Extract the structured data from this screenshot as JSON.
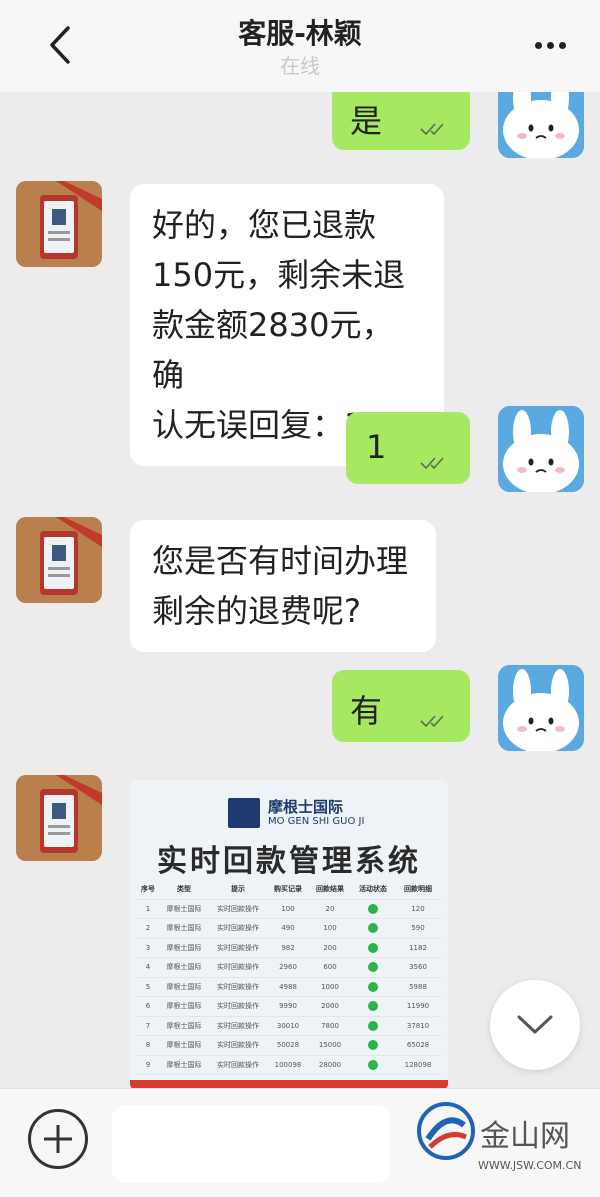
{
  "header": {
    "title": "客服-林颖",
    "status": "在线"
  },
  "messages": [
    {
      "side": "out",
      "text": "是"
    },
    {
      "side": "in",
      "lines": [
        "好的，您已退款",
        "150元，剩余未退",
        "款金额2830元，确",
        "认无误回复：1"
      ]
    },
    {
      "side": "out",
      "text": "1"
    },
    {
      "side": "in",
      "lines": [
        "您是否有时间办理",
        "剩余的退费呢?"
      ]
    },
    {
      "side": "out",
      "text": "有"
    }
  ],
  "image_message": {
    "brand_cn": "摩根士国际",
    "brand_en": "MO GEN SHI GUO JI",
    "title": "实时回款管理系统",
    "columns": [
      "序号",
      "类型",
      "提示",
      "购买记录",
      "回款结果",
      "活动状态",
      "回款明细"
    ],
    "rows": [
      [
        "1",
        "摩根士国际",
        "实时回款操作",
        "100",
        "20",
        "✓",
        "120"
      ],
      [
        "2",
        "摩根士国际",
        "实时回款操作",
        "490",
        "100",
        "✓",
        "590"
      ],
      [
        "3",
        "摩根士国际",
        "实时回款操作",
        "982",
        "200",
        "✓",
        "1182"
      ],
      [
        "4",
        "摩根士国际",
        "实时回款操作",
        "2960",
        "600",
        "✓",
        "3560"
      ],
      [
        "5",
        "摩根士国际",
        "实时回款操作",
        "4988",
        "1000",
        "✓",
        "5988"
      ],
      [
        "6",
        "摩根士国际",
        "实时回款操作",
        "9990",
        "2000",
        "✓",
        "11990"
      ],
      [
        "7",
        "摩根士国际",
        "实时回款操作",
        "30010",
        "7800",
        "✓",
        "37810"
      ],
      [
        "8",
        "摩根士国际",
        "实时回款操作",
        "50028",
        "15000",
        "✓",
        "65028"
      ],
      [
        "9",
        "摩根士国际",
        "实时回款操作",
        "100098",
        "28000",
        "✓",
        "128098"
      ]
    ]
  },
  "watermark": {
    "name": "金山网",
    "url": "WWW.JSW.COM.CN"
  },
  "colors": {
    "outgoing_bubble": "#a6e860",
    "incoming_bubble": "#ffffff",
    "background": "#ececec"
  },
  "icons": {
    "back": "chevron-left-icon",
    "more": "more-dots-icon",
    "read": "double-check-icon",
    "scroll_down": "chevron-down-icon",
    "add": "plus-icon"
  }
}
